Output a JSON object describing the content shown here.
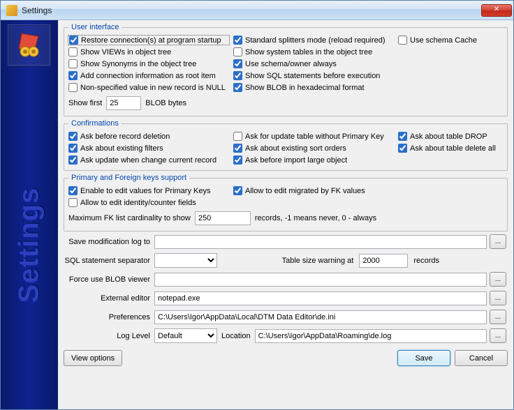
{
  "window": {
    "title": "Settings",
    "close": "✕",
    "sidebar_text": "Settings"
  },
  "groups": {
    "ui": {
      "legend": "User interface",
      "restore": {
        "label": "Restore connection(s) at program startup",
        "checked": true
      },
      "splitters": {
        "label": "Standard splitters mode (reload required)",
        "checked": true
      },
      "cache": {
        "label": "Use schema Cache",
        "checked": false
      },
      "views": {
        "label": "Show VIEWs in object tree",
        "checked": false
      },
      "systables": {
        "label": "Show system tables in the object tree",
        "checked": false
      },
      "synonyms": {
        "label": "Show Synonyms in the object tree",
        "checked": false
      },
      "schema": {
        "label": "Use schema/owner always",
        "checked": true
      },
      "rootinfo": {
        "label": "Add connection information as root item",
        "checked": true
      },
      "showsql": {
        "label": "Show SQL statements before execution",
        "checked": true
      },
      "nullspec": {
        "label": "Non-specified value in new record is NULL",
        "checked": false
      },
      "blobhex": {
        "label": "Show BLOB in hexadecimal format",
        "checked": true
      },
      "showfirst_label": "Show first",
      "showfirst_value": "25",
      "showfirst_suffix": "BLOB bytes"
    },
    "confirm": {
      "legend": "Confirmations",
      "del": {
        "label": "Ask before record deletion",
        "checked": true
      },
      "updnopk": {
        "label": "Ask for update table without Primary Key",
        "checked": false
      },
      "drop": {
        "label": "Ask about table DROP",
        "checked": true
      },
      "filters": {
        "label": "Ask about existing filters",
        "checked": true
      },
      "sorts": {
        "label": "Ask about existing sort orders",
        "checked": true
      },
      "delall": {
        "label": "Ask about table delete all",
        "checked": true
      },
      "updcur": {
        "label": "Ask update when change current record",
        "checked": true
      },
      "implob": {
        "label": "Ask before import large object",
        "checked": true
      }
    },
    "keys": {
      "legend": "Primary and Foreign keys support",
      "editpk": {
        "label": "Enable to edit values for Primary Keys",
        "checked": true
      },
      "editfk": {
        "label": "Allow to edit migrated by FK values",
        "checked": true
      },
      "identity": {
        "label": "Allow to edit identity/counter fields",
        "checked": false
      },
      "maxfk_label": "Maximum FK list cardinality to show",
      "maxfk_value": "250",
      "maxfk_suffix": "records, -1 means never, 0 - always"
    }
  },
  "lower": {
    "savemodlog_label": "Save modification log to",
    "savemodlog_value": "",
    "sqlsep_label": "SQL statement separator",
    "sqlsep_value": "",
    "tablesize_label": "Table size warning at",
    "tablesize_value": "2000",
    "tablesize_suffix": "records",
    "forceblob_label": "Force use BLOB viewer",
    "forceblob_value": "",
    "exteditor_label": "External editor",
    "exteditor_value": "notepad.exe",
    "prefs_label": "Preferences",
    "prefs_value": "C:\\Users\\Igor\\AppData\\Local\\DTM Data Editor\\de.ini",
    "loglevel_label": "Log Level",
    "loglevel_value": "Default",
    "location_label": "Location",
    "location_value": "C:\\Users\\Igor\\AppData\\Roaming\\de.log"
  },
  "buttons": {
    "viewoptions": "View options",
    "save": "Save",
    "cancel": "Cancel",
    "browse": "..."
  }
}
